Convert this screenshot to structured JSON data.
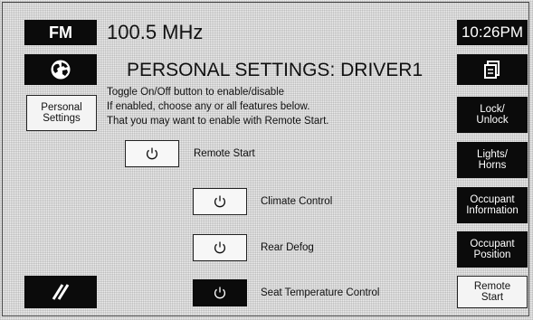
{
  "header": {
    "band": "FM",
    "frequency": "100.5 MHz",
    "time": "10:26PM"
  },
  "title": "PERSONAL SETTINGS: DRIVER1",
  "instructions": [
    "Toggle On/Off button to enable/disable",
    "If enabled, choose any or all features below.",
    "That you may want to enable with Remote Start."
  ],
  "left_nav": {
    "personal_settings": [
      "Personal",
      "Settings"
    ]
  },
  "right_nav": {
    "lock": [
      "Lock/",
      "Unlock"
    ],
    "lights": [
      "Lights/",
      "Horns"
    ],
    "occ_info": [
      "Occupant",
      "Information"
    ],
    "occ_pos": [
      "Occupant",
      "Position"
    ],
    "remote": [
      "Remote",
      "Start"
    ]
  },
  "toggles": [
    {
      "label": "Remote Start",
      "state": "off"
    },
    {
      "label": "Climate Control",
      "state": "off"
    },
    {
      "label": "Rear Defog",
      "state": "off"
    },
    {
      "label": "Seat Temperature Control",
      "state": "on"
    }
  ],
  "icons": {
    "globe": "globe-icon",
    "document": "document-icon",
    "power": "power-icon",
    "tool": "stripes-icon"
  }
}
